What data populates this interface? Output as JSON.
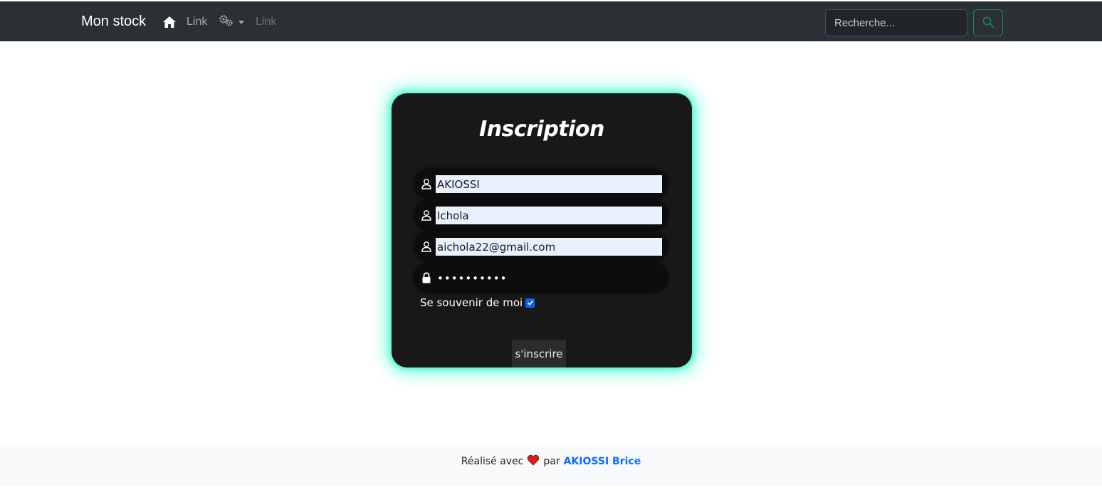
{
  "navbar": {
    "brand": "Mon stock",
    "home_icon": "home-icon",
    "link1": "Link",
    "settings_icon": "gears-icon",
    "link2": "Link",
    "search_placeholder": "Recherche...",
    "search_icon": "search-icon"
  },
  "form": {
    "title": "Inscription",
    "fields": [
      {
        "icon": "user-icon",
        "value": "AKIOSSI"
      },
      {
        "icon": "user-icon",
        "value": "Ichola"
      },
      {
        "icon": "user-icon",
        "value": "aichola22@gmail.com"
      },
      {
        "icon": "lock-icon",
        "value": "••••••••••"
      }
    ],
    "remember_label": "Se souvenir de moi",
    "remember_checked": true,
    "submit_label": "s'inscrire"
  },
  "footer": {
    "prefix": "Réalisé avec",
    "heart_icon": "heart-icon",
    "middle": "par",
    "author": "AKIOSSI Brice"
  },
  "colors": {
    "navbar_bg": "#2b3035",
    "card_bg": "#181818",
    "card_glow": "#5cf7d3",
    "search_button_border": "#198754",
    "author_link": "#0d6efd",
    "heart": "#dc1c1c"
  }
}
